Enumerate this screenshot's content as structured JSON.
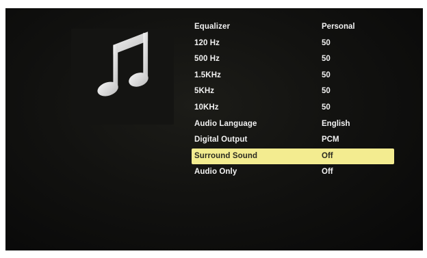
{
  "menu": {
    "items": [
      {
        "label": "Equalizer",
        "value": "Personal",
        "selected": false
      },
      {
        "label": "120 Hz",
        "value": "50",
        "selected": false
      },
      {
        "label": "500 Hz",
        "value": "50",
        "selected": false
      },
      {
        "label": "1.5KHz",
        "value": "50",
        "selected": false
      },
      {
        "label": "5KHz",
        "value": "50",
        "selected": false
      },
      {
        "label": "10KHz",
        "value": "50",
        "selected": false
      },
      {
        "label": "Audio Language",
        "value": "English",
        "selected": false
      },
      {
        "label": "Digital Output",
        "value": "PCM",
        "selected": false
      },
      {
        "label": "Surround Sound",
        "value": "Off",
        "selected": true
      },
      {
        "label": "Audio Only",
        "value": "Off",
        "selected": false
      }
    ]
  },
  "art": {
    "icon": "music-note-icon"
  },
  "colors": {
    "highlight": "#f3ec90",
    "text": "#f2f2f2",
    "selected_text": "#2a2a20",
    "background": "#121210"
  }
}
